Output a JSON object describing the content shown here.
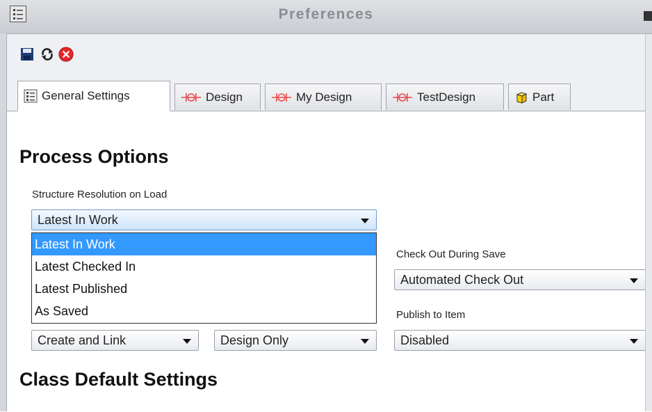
{
  "window": {
    "title": "Preferences"
  },
  "tabs": [
    {
      "label": "General Settings"
    },
    {
      "label": "Design"
    },
    {
      "label": "My Design"
    },
    {
      "label": "TestDesign"
    },
    {
      "label": "Part"
    }
  ],
  "sections": {
    "process_options": "Process Options",
    "class_default": "Class Default Settings"
  },
  "structure_resolution": {
    "label": "Structure Resolution on Load",
    "value": "Latest In Work",
    "options": [
      "Latest In Work",
      "Latest Checked In",
      "Latest Published",
      "As Saved"
    ]
  },
  "check_out": {
    "label": "Check Out During Save",
    "value": "Automated Check Out"
  },
  "publish": {
    "label": "Publish to Item",
    "value": "Disabled"
  },
  "link_mode": {
    "value": "Create and Link"
  },
  "design_scope": {
    "value": "Design Only"
  },
  "colors": {
    "selection": "#3399ff",
    "close_red": "#e8262b"
  }
}
